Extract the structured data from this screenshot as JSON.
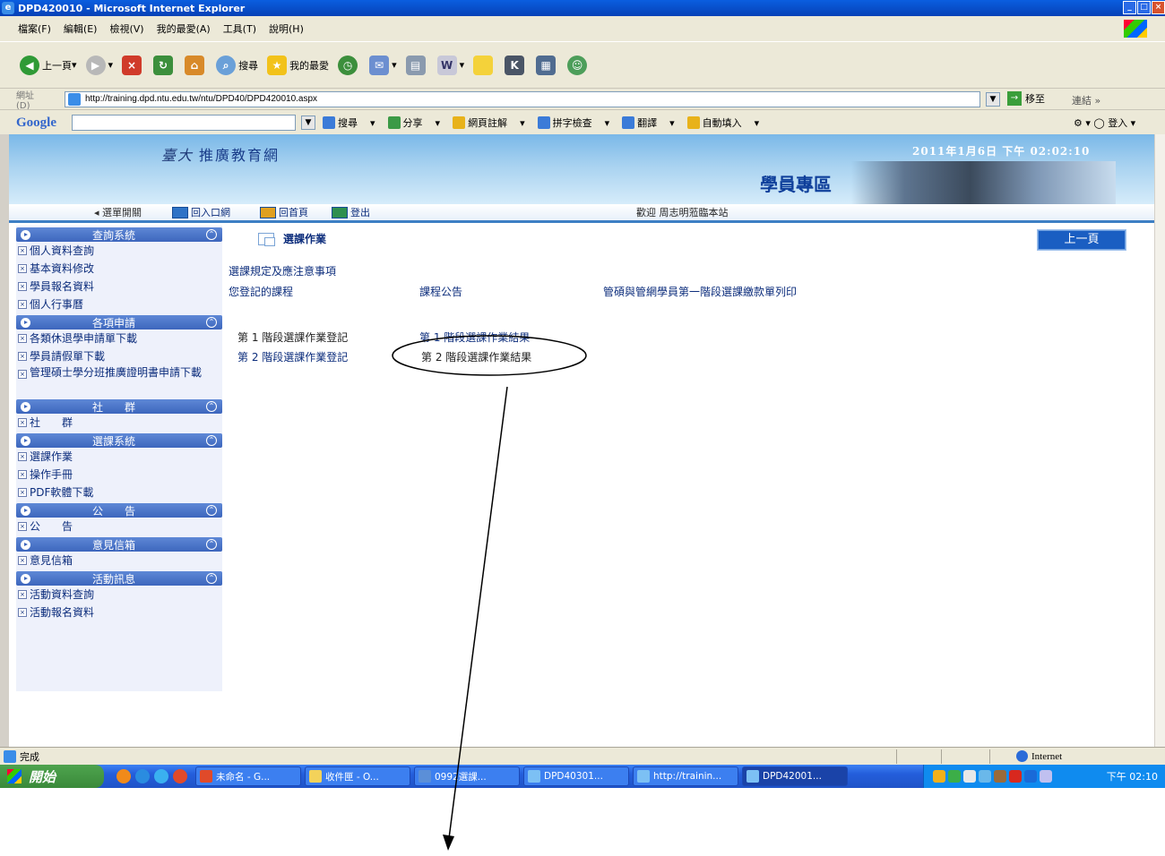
{
  "window": {
    "title": "DPD420010 - Microsoft Internet Explorer",
    "menu": [
      "檔案(F)",
      "編輯(E)",
      "檢視(V)",
      "我的最愛(A)",
      "工具(T)",
      "說明(H)"
    ]
  },
  "toolbar": {
    "back_label": "上一頁",
    "search_label": "搜尋",
    "favorites_label": "我的最愛"
  },
  "address": {
    "label": "網址(D)",
    "url": "http://training.dpd.ntu.edu.tw/ntu/DPD40/DPD420010.aspx",
    "go_label": "移至",
    "links_label": "連結"
  },
  "google": {
    "logo": "Google",
    "items": [
      "搜尋",
      "分享",
      "網頁註解",
      "拼字檢查",
      "翻譯",
      "自動填入"
    ],
    "signin_label": "登入"
  },
  "site": {
    "logo_mark": "臺大",
    "logo_text": "推廣教育網",
    "date": "2011年1月6日 下午 02:02:10",
    "section_title": "學員專區"
  },
  "nav": {
    "menu_toggle": "選單開關",
    "portal": "回入口網",
    "home": "回首頁",
    "logout": "登出",
    "welcome": "歡迎 周志明蒞臨本站"
  },
  "sidebar": [
    {
      "title": "查詢系統",
      "items": [
        "個人資料查詢",
        "基本資料修改",
        "學員報名資料",
        "個人行事曆"
      ]
    },
    {
      "title": "各項申請",
      "items": [
        "各類休退學申請單下載",
        "學員請假單下載",
        "管理碩士學分班推廣證明書申請下載"
      ]
    },
    {
      "title": "社　　群",
      "items": [
        "社　　群"
      ]
    },
    {
      "title": "選課系統",
      "items": [
        "選課作業",
        "操作手冊",
        "PDF軟體下載"
      ]
    },
    {
      "title": "公　　告",
      "items": [
        "公　　告"
      ]
    },
    {
      "title": "意見信箱",
      "items": [
        "意見信箱"
      ]
    },
    {
      "title": "活動訊息",
      "items": [
        "活動資料查詢",
        "活動報名資料"
      ]
    }
  ],
  "main": {
    "page_title": "選課作業",
    "back_button": "上一頁",
    "rules_link": "選課規定及應注意事項",
    "registered_courses": "您登記的課程",
    "course_announcements": "課程公告",
    "payment_print": "管碩與管網學員第一階段選課繳款單列印",
    "stage1_register": "第 1 階段選課作業登記",
    "stage1_result": "第 1 階段選課作業結果",
    "stage2_register": "第 2 階段選課作業登記",
    "stage2_result": "第 2 階段選課作業結果"
  },
  "status": {
    "done": "完成",
    "zone": "Internet"
  },
  "taskbar": {
    "start": "開始",
    "tasks": [
      "未命名 - G...",
      "收件匣 - O...",
      "0992選課...",
      "DPD40301...",
      "http://trainin...",
      "DPD42001..."
    ],
    "clock": "下午 02:10"
  }
}
